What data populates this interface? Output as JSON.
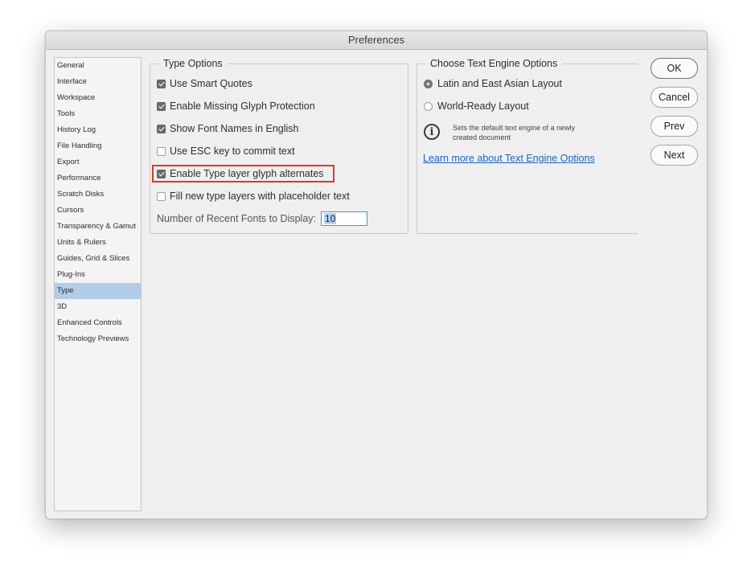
{
  "window": {
    "title": "Preferences"
  },
  "sidebar": {
    "items": [
      {
        "label": "General"
      },
      {
        "label": "Interface"
      },
      {
        "label": "Workspace"
      },
      {
        "label": "Tools"
      },
      {
        "label": "History Log"
      },
      {
        "label": "File Handling"
      },
      {
        "label": "Export"
      },
      {
        "label": "Performance"
      },
      {
        "label": "Scratch Disks"
      },
      {
        "label": "Cursors"
      },
      {
        "label": "Transparency & Gamut"
      },
      {
        "label": "Units & Rulers"
      },
      {
        "label": "Guides, Grid & Slices"
      },
      {
        "label": "Plug-Ins"
      },
      {
        "label": "Type"
      },
      {
        "label": "3D"
      },
      {
        "label": "Enhanced Controls"
      },
      {
        "label": "Technology Previews"
      }
    ],
    "selected": "Type"
  },
  "type_options": {
    "title": "Type Options",
    "checkboxes": [
      {
        "label": "Use Smart Quotes",
        "checked": true
      },
      {
        "label": "Enable Missing Glyph Protection",
        "checked": true
      },
      {
        "label": "Show Font Names in English",
        "checked": true
      },
      {
        "label": "Use ESC key to commit text",
        "checked": false
      },
      {
        "label": "Enable Type layer glyph alternates",
        "checked": true,
        "highlighted": true
      },
      {
        "label": "Fill new type layers with placeholder text",
        "checked": false
      }
    ],
    "recent_fonts_label": "Number of Recent Fonts to Display:",
    "recent_fonts_value": "10"
  },
  "engine_options": {
    "title": "Choose Text Engine Options",
    "radios": [
      {
        "label": "Latin and East Asian Layout",
        "checked": true
      },
      {
        "label": "World-Ready Layout",
        "checked": false
      }
    ],
    "info_icon": "info-icon",
    "info_text": "Sets the default text engine of a newly created document",
    "link": "Learn more about Text Engine Options"
  },
  "buttons": {
    "ok": "OK",
    "cancel": "Cancel",
    "prev": "Prev",
    "next": "Next"
  },
  "colors": {
    "selection": "#b3cde6",
    "highlight_border": "#d83a2f",
    "link": "#1a64c4"
  }
}
